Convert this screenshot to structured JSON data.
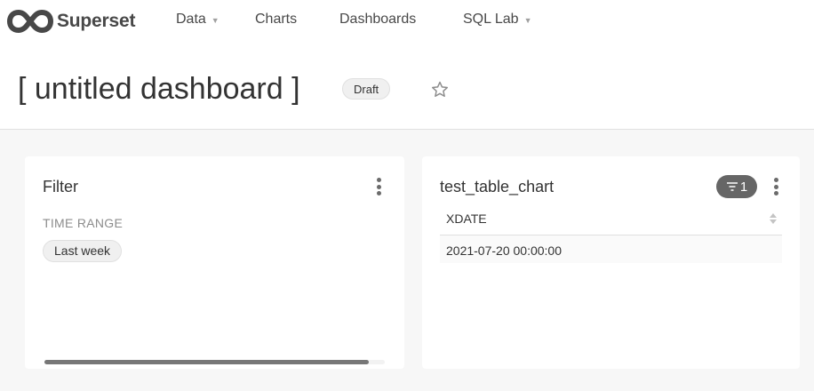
{
  "navbar": {
    "brand": "Superset",
    "items": [
      {
        "label": "Data",
        "caret": true
      },
      {
        "label": "Charts",
        "caret": false
      },
      {
        "label": "Dashboards",
        "caret": false
      },
      {
        "label": "SQL Lab",
        "caret": true
      }
    ]
  },
  "header": {
    "title": "[ untitled dashboard ]",
    "badge": "Draft",
    "star_icon": "star-outline-icon"
  },
  "filter_card": {
    "title": "Filter",
    "label": "TIME RANGE",
    "chip": "Last week"
  },
  "table_card": {
    "title": "test_table_chart",
    "filter_count": "1",
    "column": "XDATE",
    "rows": [
      "2021-07-20 00:00:00"
    ]
  },
  "colors": {
    "background": "#f7f7f7",
    "card": "#ffffff",
    "text": "#333333",
    "muted": "#8c8c8c",
    "pill": "#666666"
  }
}
